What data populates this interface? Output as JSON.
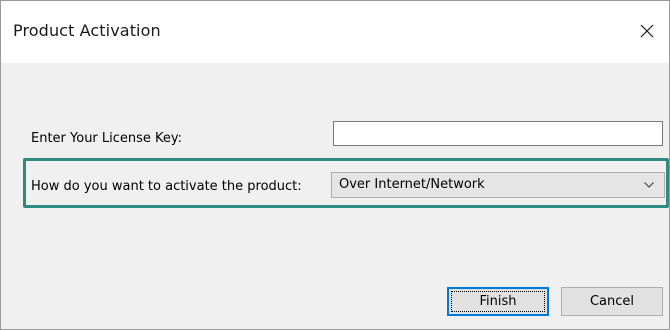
{
  "window": {
    "title": "Product Activation",
    "close_icon": "close-icon"
  },
  "form": {
    "license_label": "Enter Your License Key:",
    "license_value": "",
    "method_label": "How do you want to activate the product:",
    "method_selected": "Over Internet/Network",
    "method_arrow_icon": "chevron-down-icon",
    "highlight_color": "#2e8b81"
  },
  "buttons": {
    "finish_label": "Finish",
    "cancel_label": "Cancel",
    "focus_color": "#0078d7"
  }
}
